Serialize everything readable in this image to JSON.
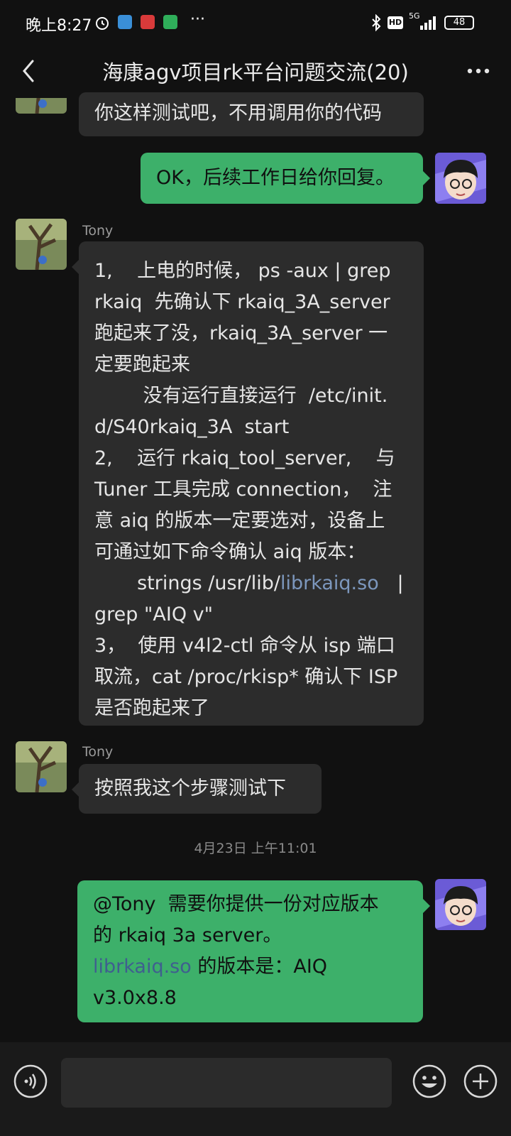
{
  "status_bar": {
    "time": "晚上8:27",
    "battery": "48",
    "network": "5G"
  },
  "header": {
    "title": "海康agv项目rk平台问题交流(20)"
  },
  "messages": [
    {
      "side": "left",
      "sender": "",
      "lines": [
        "你这样测试吧，不用调用你的代码"
      ]
    },
    {
      "side": "right",
      "lines": [
        "OK，后续工作日给你回复。"
      ]
    },
    {
      "side": "left",
      "sender": "Tony",
      "lines": [
        "1,    上电的时候， ps -aux | grep",
        "rkaiq  先确认下 rkaiq_3A_server",
        "跑起来了没，rkaiq_3A_server 一",
        "定要跑起来",
        "        没有运行直接运行  /etc/init.",
        "d/S40rkaiq_3A  start",
        "2,    运行 rkaiq_tool_server,    与",
        "Tuner 工具完成 connection，  注",
        "意 aiq 的版本一定要选对，设备上",
        "可通过如下命令确认 aiq 版本：",
        "       strings /usr/lib/",
        "grep \"AIQ v\"",
        "3，  使用 v4l2-ctl 命令从 isp 端口",
        "取流，cat /proc/rkisp* 确认下 ISP",
        "是否跑起来了"
      ],
      "link_text": "librkaiq.so",
      "link_suffix": "   |"
    },
    {
      "side": "left",
      "sender": "Tony",
      "lines": [
        "按照我这个步骤测试下"
      ]
    },
    {
      "side": "right",
      "lines": [
        "@Tony  需要你提供一份对应版本",
        "的 rkaiq 3a server。",
        " 的版本是：AIQ",
        "v3.0x8.8"
      ],
      "link_text": "librkaiq.so"
    }
  ],
  "timestamp": "4月23日 上午11:01",
  "colors": {
    "background": "#111111",
    "bubble_left": "#2c2c2c",
    "bubble_right": "#3db06a",
    "link": "#7c97bd"
  },
  "icons": [
    "alarm-icon",
    "app-notify-icon",
    "bluetooth-icon",
    "hd-icon",
    "signal-icon",
    "battery-icon",
    "back-icon",
    "more-icon",
    "voice-icon",
    "emoji-icon",
    "plus-icon"
  ]
}
